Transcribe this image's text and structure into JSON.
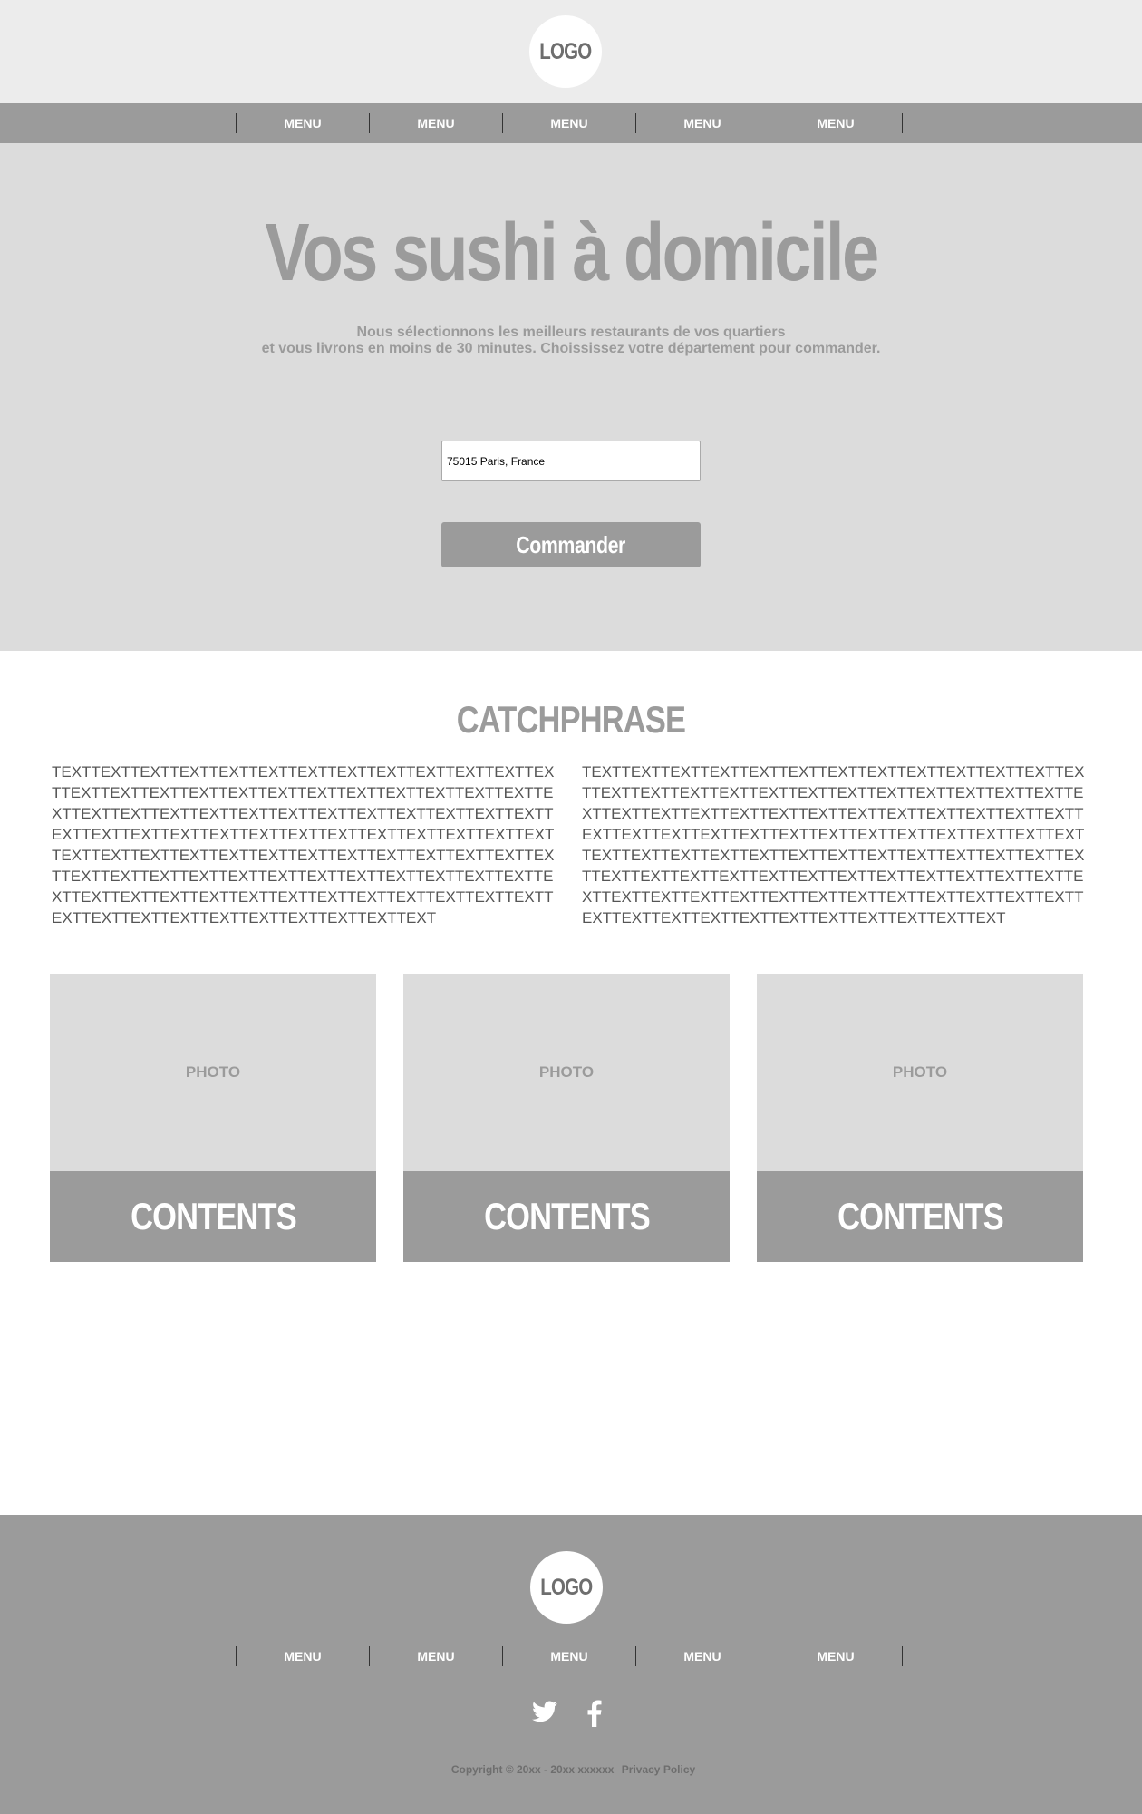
{
  "header": {
    "logo": "LOGO"
  },
  "nav": {
    "items": [
      "MENU",
      "MENU",
      "MENU",
      "MENU",
      "MENU"
    ]
  },
  "hero": {
    "title": "Vos sushi à domicile",
    "subtitle_line1": "Nous sélectionnons les meilleurs restaurants de vos quartiers",
    "subtitle_line2": "et vous livrons en moins de 30 minutes. Choississez votre département pour commander.",
    "address_value": "75015 Paris, France",
    "order_button": "Commander"
  },
  "content": {
    "catchphrase": "CATCHPHRASE",
    "text_left": "TEXTTEXTTEXTTEXTTEXTTEXTTEXTTEXTTEXTTEXTTEXTTEXTTEXTTEXTTEXTTEXTTEXTTEXTTEXTTEXTTEXTTEXTTEXTTEXTTEXTTEXTTEXTTEXTTEXTTEXTTEXTTEXTTEXTTEXTTEXTTEXTTEXTTEXTTEXTTEXTTEXTTEXTTEXTTEXTTEXTTEXTTEXTTEXTTEXTTEXTTEXTTEXTTEXTTEXTTEXTTEXTTEXTTEXTTEXTTEXTTEXTTEXTTEXTTEXTTEXTTEXTTEXTTEXTTEXTTEXTTEXTTEXTTEXTTEXTTEXTTEXTTEXTTEXTTEXTTEXTTEXTTEXTTEXTTEXTTEXTTEXTTEXTTEXTTEXTTEXTTEXTTEXTTEXTTEXTTEXTTEXTTEXTTEXTTEXT",
    "text_right": "TEXTTEXTTEXTTEXTTEXTTEXTTEXTTEXTTEXTTEXTTEXTTEXTTEXTTEXTTEXTTEXTTEXTTEXTTEXTTEXTTEXTTEXTTEXTTEXTTEXTTEXTTEXTTEXTTEXTTEXTTEXTTEXTTEXTTEXTTEXTTEXTTEXTTEXTTEXTTEXTTEXTTEXTTEXTTEXTTEXTTEXTTEXTTEXTTEXTTEXTTEXTTEXTTEXTTEXTTEXTTEXTTEXTTEXTTEXTTEXTTEXTTEXTTEXTTEXTTEXTTEXTTEXTTEXTTEXTTEXTTEXTTEXTTEXTTEXTTEXTTEXTTEXTTEXTTEXTTEXTTEXTTEXTTEXTTEXTTEXTTEXTTEXTTEXTTEXTTEXTTEXTTEXTTEXTTEXTTEXTTEXTTEXTTEXTTEXTTEXT"
  },
  "cards": [
    {
      "photo": "PHOTO",
      "caption": "CONTENTS"
    },
    {
      "photo": "PHOTO",
      "caption": "CONTENTS"
    },
    {
      "photo": "PHOTO",
      "caption": "CONTENTS"
    }
  ],
  "footer": {
    "logo": "LOGO",
    "nav": [
      "MENU",
      "MENU",
      "MENU",
      "MENU",
      "MENU"
    ],
    "social_icons": [
      "twitter-icon",
      "facebook-icon"
    ],
    "copyright": "Copyright © 20xx - 20xx xxxxxx",
    "privacy": "Privacy Policy"
  }
}
